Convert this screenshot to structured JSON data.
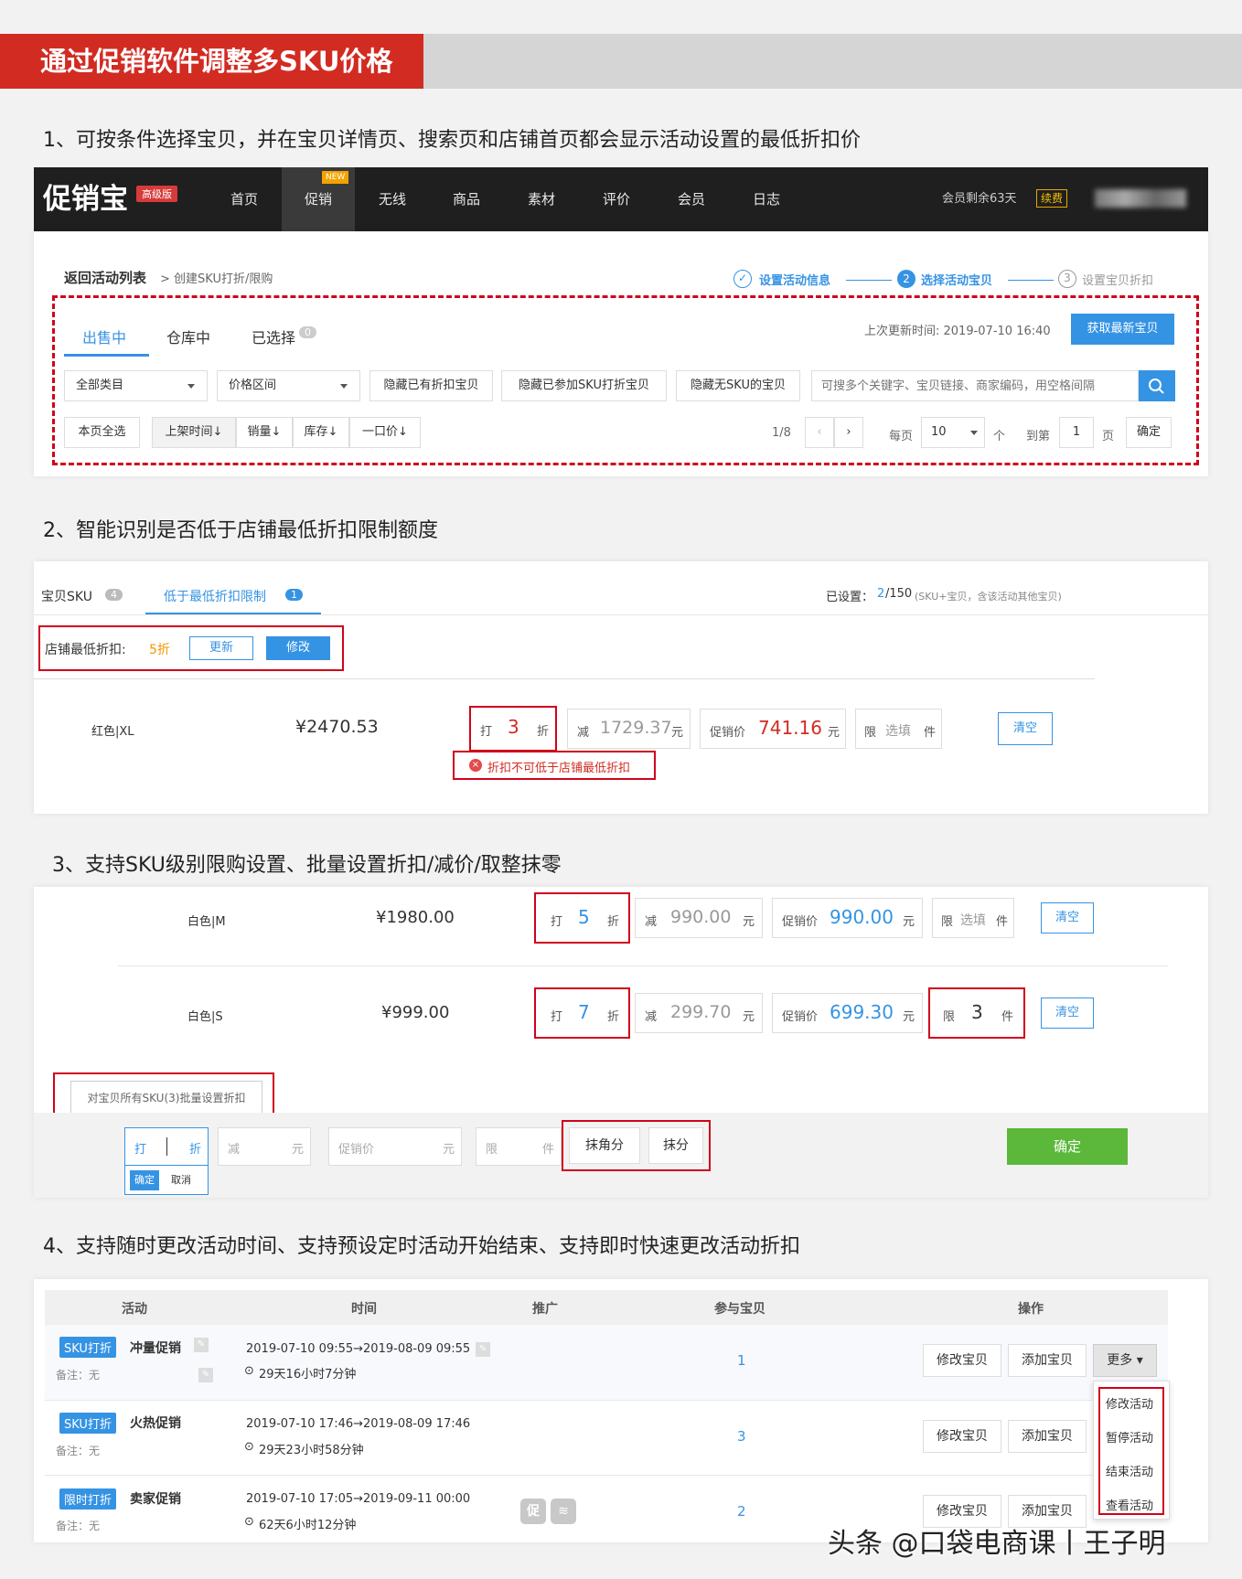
{
  "banner": {
    "title": "通过促销软件调整多SKU价格"
  },
  "sections": {
    "s1": "1、可按条件选择宝贝，并在宝贝详情页、搜索页和店铺首页都会显示活动设置的最低折扣价",
    "s2": "2、智能识别是否低于店铺最低折扣限制额度",
    "s3": "3、支持SKU级别限购设置、批量设置折扣/减价/取整抹零",
    "s4": "4、支持随时更改活动时间、支持预设定时活动开始结束、支持即时快速更改活动折扣"
  },
  "nav": {
    "logo": "促销宝",
    "edition": "高级版",
    "new_tag": "NEW",
    "items": [
      "首页",
      "促销",
      "无线",
      "商品",
      "素材",
      "评价",
      "会员",
      "日志"
    ],
    "member": "会员剩余63天",
    "renew": "续费"
  },
  "panel1": {
    "back": "返回活动列表",
    "crumb": "> 创建SKU打折/限购",
    "steps": [
      "设置活动信息",
      "选择活动宝贝",
      "设置宝贝折扣"
    ],
    "step_nums": [
      "2",
      "3"
    ],
    "tabs": [
      "出售中",
      "仓库中",
      "已选择"
    ],
    "selected_count": "0",
    "update_time": "上次更新时间: 2019-07-10 16:40",
    "fetch_btn": "获取最新宝贝",
    "filters": [
      "全部类目",
      "价格区间",
      "隐藏已有折扣宝贝",
      "隐藏已参加SKU打折宝贝",
      "隐藏无SKU的宝贝"
    ],
    "search_placeholder": "可搜多个关键字、宝贝链接、商家编码，用空格间隔",
    "sort": [
      "本页全选",
      "上架时间↓",
      "销量↓",
      "库存↓",
      "一口价↓"
    ],
    "pager": {
      "page": "1/8",
      "per_page_label": "每页",
      "per_page": "10",
      "unit": "个",
      "goto": "到第",
      "goto_page": "1",
      "page_unit": "页",
      "confirm": "确定"
    }
  },
  "panel2": {
    "tab1": "宝贝SKU",
    "tab1_count": "4",
    "tab2": "低于最低折扣限制",
    "tab2_count": "1",
    "set_label": "已设置：",
    "set_value": "2",
    "set_total": "/150",
    "set_note": "(SKU+宝贝，含该活动其他宝贝)",
    "min_label": "店铺最低折扣:",
    "min_value": "5折",
    "update_btn": "更新",
    "modify_btn": "修改",
    "row": {
      "sku": "红色|XL",
      "price": "¥2470.53",
      "da": "打",
      "discount": "3",
      "zhe": "折",
      "jian": "减",
      "reduce": "1729.37",
      "yuan": "元",
      "promo_label": "促销价",
      "promo": "741.16",
      "xian": "限",
      "limit": "选填",
      "jian_unit": "件",
      "clear": "清空"
    },
    "error": "折扣不可低于店铺最低折扣"
  },
  "panel3": {
    "rows": [
      {
        "sku": "白色|M",
        "price": "¥1980.00",
        "discount": "5",
        "reduce": "990.00",
        "promo": "990.00",
        "limit": "选填"
      },
      {
        "sku": "白色|S",
        "price": "¥999.00",
        "discount": "7",
        "reduce": "299.70",
        "promo": "699.30",
        "limit": "3"
      }
    ],
    "labels": {
      "da": "打",
      "zhe": "折",
      "jian": "减",
      "yuan": "元",
      "promo_label": "促销价",
      "xian": "限",
      "jian_unit": "件",
      "clear": "清空"
    },
    "tooltip": "对宝贝所有SKU(3)批量设置折扣",
    "batch": {
      "da": "打",
      "zhe": "折",
      "jian": "减",
      "yuan": "元",
      "promo": "促销价",
      "xian": "限",
      "unit": "件",
      "ok": "确定",
      "cancel": "取消",
      "round1": "抹角分",
      "round2": "抹分",
      "confirm": "确定"
    }
  },
  "panel4": {
    "headers": [
      "活动",
      "时间",
      "推广",
      "参与宝贝",
      "操作"
    ],
    "rows": [
      {
        "tag": "SKU打折",
        "name": "冲量促销",
        "note": "备注：无",
        "time": "2019-07-10 09:55→2019-08-09 09:55",
        "left": "29天16小时7分钟",
        "count": "1"
      },
      {
        "tag": "SKU打折",
        "name": "火热促销",
        "note": "备注：无",
        "time": "2019-07-10 17:46→2019-08-09 17:46",
        "left": "29天23小时58分钟",
        "count": "3"
      },
      {
        "tag": "限时打折",
        "name": "卖家促销",
        "note": "备注：无",
        "time": "2019-07-10 17:05→2019-09-11 00:00",
        "left": "62天6小时12分钟",
        "count": "2"
      }
    ],
    "edit_btn": "修改宝贝",
    "add_btn": "添加宝贝",
    "more_btn": "更多",
    "promo_icon": "促",
    "menu": [
      "修改活动",
      "暂停活动",
      "结束活动",
      "查看活动"
    ]
  },
  "watermark": "头条 @口袋电商课丨王子明",
  "colors": {
    "red": "#d22b22",
    "blue": "#3593e4",
    "green": "#5cb83a",
    "dark": "#1f1f1f"
  }
}
